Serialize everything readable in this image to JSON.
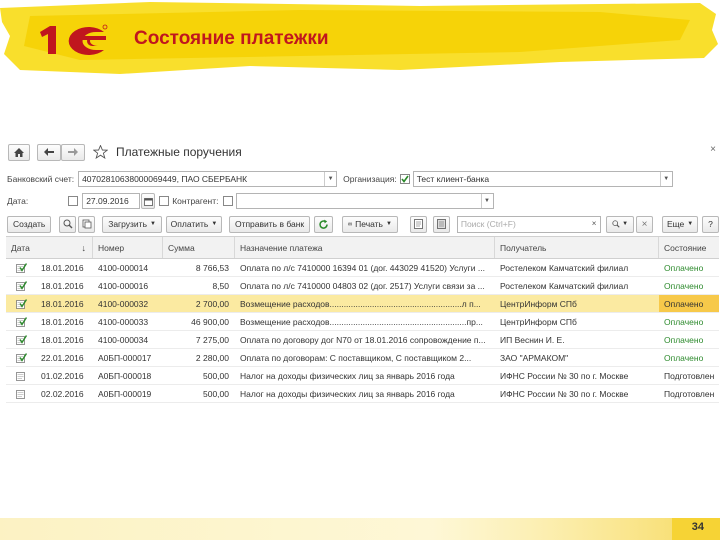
{
  "slide": {
    "title": "Состояние платежки",
    "page_number": "34",
    "accent_color": "#c0161e",
    "highlight_color": "#f7d400"
  },
  "app": {
    "form_title": "Платежные поручения",
    "filters": {
      "bank_account_label": "Банковский счет:",
      "bank_account_value": "40702810638000069449, ПАО СБЕРБАНК",
      "organization_label": "Организация:",
      "organization_value": "Тест клиент-банка",
      "date_label": "Дата:",
      "date_value": "27.09.2016",
      "counterparty_label": "Контрагент:",
      "counterparty_value": ""
    },
    "toolbar": {
      "create": "Создать",
      "load": "Загрузить",
      "pay": "Оплатить",
      "send_to_bank": "Отправить в банк",
      "print": "Печать",
      "search_placeholder": "Поиск (Ctrl+F)",
      "more": "Еще",
      "help": "?"
    },
    "table": {
      "columns": [
        "Дата",
        "Номер",
        "Сумма",
        "Назначение платежа",
        "Получатель",
        "Состояние"
      ],
      "rows": [
        {
          "date": "18.01.2016",
          "number": "4100-000014",
          "amount": "8 766,53",
          "purpose": "Оплата по л/с 7410000 16394 01 (дог. 443029 41520) Услуги ...",
          "payee": "Ростелеком Камчатский филиал",
          "status": "Оплачено",
          "status_kind": "ok",
          "selected": false
        },
        {
          "date": "18.01.2016",
          "number": "4100-000016",
          "amount": "8,50",
          "purpose": "Оплата по л/с 7410000 04803 02 (дог. 2517) Услуги связи за ...",
          "payee": "Ростелеком Камчатский филиал",
          "status": "Оплачено",
          "status_kind": "ok",
          "selected": false
        },
        {
          "date": "18.01.2016",
          "number": "4100-000032",
          "amount": "2 700,00",
          "purpose": "Возмещение расходов........................................................л п...",
          "payee": "ЦентрИнформ СПб",
          "status": "Оплачено",
          "status_kind": "ok",
          "selected": true
        },
        {
          "date": "18.01.2016",
          "number": "4100-000033",
          "amount": "46 900,00",
          "purpose": "Возмещение расходов..........................................................пр...",
          "payee": "ЦентрИнформ СПб",
          "status": "Оплачено",
          "status_kind": "ok",
          "selected": false
        },
        {
          "date": "18.01.2016",
          "number": "4100-000034",
          "amount": "7 275,00",
          "purpose": "Оплата по договору дог N70 от 18.01.2016 сопровождение п...",
          "payee": "ИП Веснин И. Е.",
          "status": "Оплачено",
          "status_kind": "ok",
          "selected": false
        },
        {
          "date": "22.01.2016",
          "number": "А0БП-000017",
          "amount": "2 280,00",
          "purpose": "Оплата по договорам: С поставщиком, С поставщиком 2...",
          "payee": "ЗАО \"АРМАКОМ\"",
          "status": "Оплачено",
          "status_kind": "ok",
          "selected": false
        },
        {
          "date": "01.02.2016",
          "number": "А0БП-000018",
          "amount": "500,00",
          "purpose": "Налог на доходы физических лиц за январь 2016 года",
          "payee": "ИФНС России № 30 по г. Москве",
          "status": "Подготовлен",
          "status_kind": "prep",
          "selected": false
        },
        {
          "date": "02.02.2016",
          "number": "А0БП-000019",
          "amount": "500,00",
          "purpose": "Налог на доходы физических лиц за январь 2016 года",
          "payee": "ИФНС России № 30 по г. Москве",
          "status": "Подготовлен",
          "status_kind": "prep",
          "selected": false
        }
      ]
    }
  }
}
